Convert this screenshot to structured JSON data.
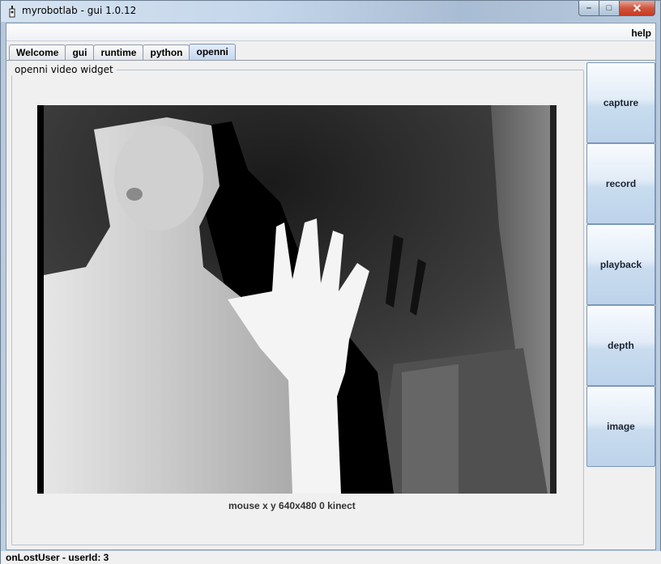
{
  "window": {
    "title": "myrobotlab - gui 1.0.12",
    "minimize_glyph": "–",
    "maximize_glyph": "□",
    "close_glyph": "✕"
  },
  "menu": {
    "help": "help"
  },
  "tabs": [
    {
      "label": "Welcome",
      "active": false
    },
    {
      "label": "gui",
      "active": false
    },
    {
      "label": "runtime",
      "active": false
    },
    {
      "label": "python",
      "active": false
    },
    {
      "label": "openni",
      "active": true
    }
  ],
  "panel": {
    "title": "openni  video widget",
    "video_status": "mouse x y  640x480  0  kinect",
    "video_description": "depth camera view"
  },
  "side_buttons": [
    "capture",
    "record",
    "playback",
    "depth",
    "image"
  ],
  "status": {
    "text": "onLostUser - userId: 3"
  }
}
